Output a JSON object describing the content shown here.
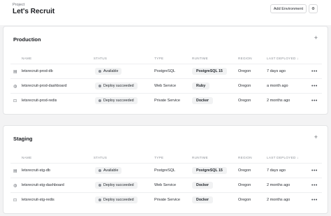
{
  "header": {
    "kicker": "Project",
    "title": "Let's Recruit",
    "add_env_label": "Add Environment",
    "settings_icon": "gear-icon"
  },
  "columns": {
    "name": "NAME",
    "status": "STATUS",
    "type": "TYPE",
    "runtime": "RUNTIME",
    "region": "REGION",
    "last_deployed": "LAST DEPLOYED ↓"
  },
  "environments": [
    {
      "title": "Production",
      "rows": [
        {
          "icon": "database-icon",
          "name": "letsrecruit-prod-db",
          "status": "Available",
          "type": "PostgreSQL",
          "runtime": "PostgreSQL 15",
          "region": "Oregon",
          "last_deployed": "7 days ago"
        },
        {
          "icon": "globe-icon",
          "name": "letsrecruit-prod-dashboard",
          "status": "Deploy succeeded",
          "type": "Web Service",
          "runtime": "Ruby",
          "region": "Oregon",
          "last_deployed": "a month ago"
        },
        {
          "icon": "lock-icon",
          "name": "letsrecruit-prod-redis",
          "status": "Deploy succeeded",
          "type": "Private Service",
          "runtime": "Docker",
          "region": "Oregon",
          "last_deployed": "2 months ago"
        }
      ]
    },
    {
      "title": "Staging",
      "rows": [
        {
          "icon": "database-icon",
          "name": "letsrecruit-stg-db",
          "status": "Available",
          "type": "PostgreSQL",
          "runtime": "PostgreSQL 15",
          "region": "Oregon",
          "last_deployed": "7 days ago"
        },
        {
          "icon": "globe-icon",
          "name": "letsrecruit-stg-dashboard",
          "status": "Deploy succeeded",
          "type": "Web Service",
          "runtime": "Docker",
          "region": "Oregon",
          "last_deployed": "2 months ago"
        },
        {
          "icon": "lock-icon",
          "name": "letsrecruit-stg-redis",
          "status": "Deploy succeeded",
          "type": "Private Service",
          "runtime": "Docker",
          "region": "Oregon",
          "last_deployed": "2 months ago"
        }
      ]
    }
  ]
}
